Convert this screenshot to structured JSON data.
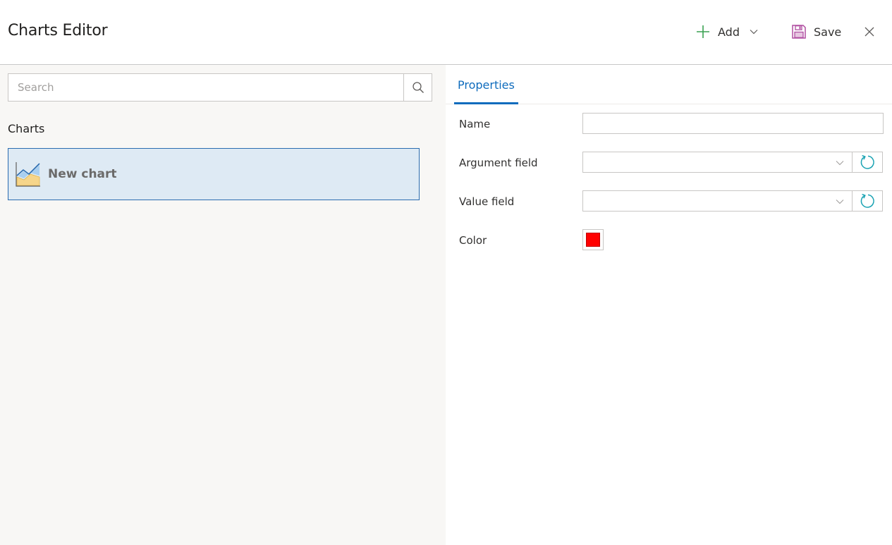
{
  "header": {
    "title": "Charts Editor",
    "add_label": "Add",
    "save_label": "Save"
  },
  "left": {
    "search_placeholder": "Search",
    "charts_heading": "Charts",
    "items": [
      {
        "label": "New chart",
        "icon": "line-area-chart-icon",
        "selected": true
      }
    ]
  },
  "properties": {
    "tab_label": "Properties",
    "name_label": "Name",
    "name_value": "",
    "argument_label": "Argument field",
    "argument_value": "",
    "value_label": "Value field",
    "value_value": "",
    "color_label": "Color",
    "color_value": "#ff0000"
  },
  "colors": {
    "accent": "#0f6cbd",
    "add_icon": "#3aa152",
    "save_icon": "#b04ea1",
    "refresh_icon": "#1ba3b3",
    "selection_bg": "#deeaf4",
    "selection_border": "#2b6cb0",
    "left_bg": "#f8f7f5"
  },
  "icons": {
    "add": "plus-icon",
    "add_dropdown": "chevron-down-icon",
    "save": "floppy-disk-icon",
    "close": "close-icon",
    "search": "search-icon",
    "refresh": "refresh-icon"
  }
}
